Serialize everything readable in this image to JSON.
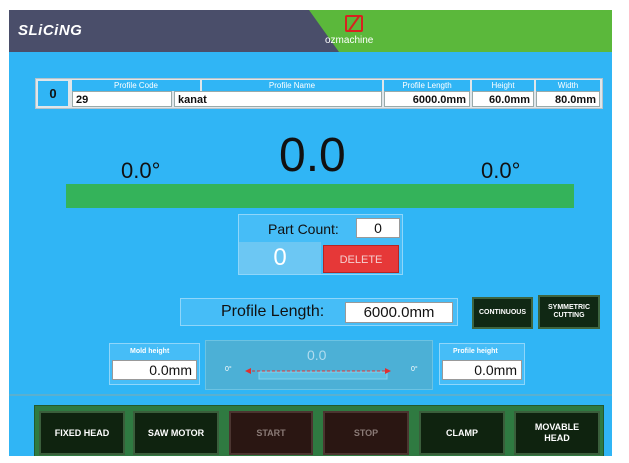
{
  "header": {
    "title": "SLiCiNG",
    "brand": "ozmachine"
  },
  "profile": {
    "index": "0",
    "headers": {
      "code": "Profile Code",
      "name": "Profile Name",
      "length": "Profile Length",
      "height": "Height",
      "width": "Width"
    },
    "values": {
      "code": "29",
      "name": "kanat",
      "length": "6000.0mm",
      "height": "60.0mm",
      "width": "80.0mm"
    }
  },
  "display": {
    "left_angle": "0.0°",
    "main_value": "0.0",
    "right_angle": "0.0°"
  },
  "part_count": {
    "label": "Part Count:",
    "value": "0",
    "counter": "0",
    "delete_label": "DELETE"
  },
  "profile_length": {
    "label": "Profile Length:",
    "value": "6000.0mm"
  },
  "mode_buttons": {
    "continuous": "CONTINUOUS",
    "symmetric": "SYMMETRIC CUTTING"
  },
  "mold_height": {
    "label": "Mold height",
    "value": "0.0mm"
  },
  "profile_height": {
    "label": "Profile height",
    "value": "0.0mm"
  },
  "diagram": {
    "value": "0.0",
    "left_angle": "0°",
    "right_angle": "0°"
  },
  "bottom_buttons": {
    "fixed_head": "FIXED HEAD",
    "saw_motor": "SAW MOTOR",
    "start": "START",
    "stop": "STOP",
    "clamp": "CLAMP",
    "movable_head": "MOVABLE HEAD"
  },
  "colors": {
    "screen_bg": "#30b5f5",
    "header_left": "#4a4e6a",
    "header_right": "#5bb83b",
    "status_bar": "#34b35a",
    "delete": "#e63838",
    "button_dark": "#0f230f"
  }
}
